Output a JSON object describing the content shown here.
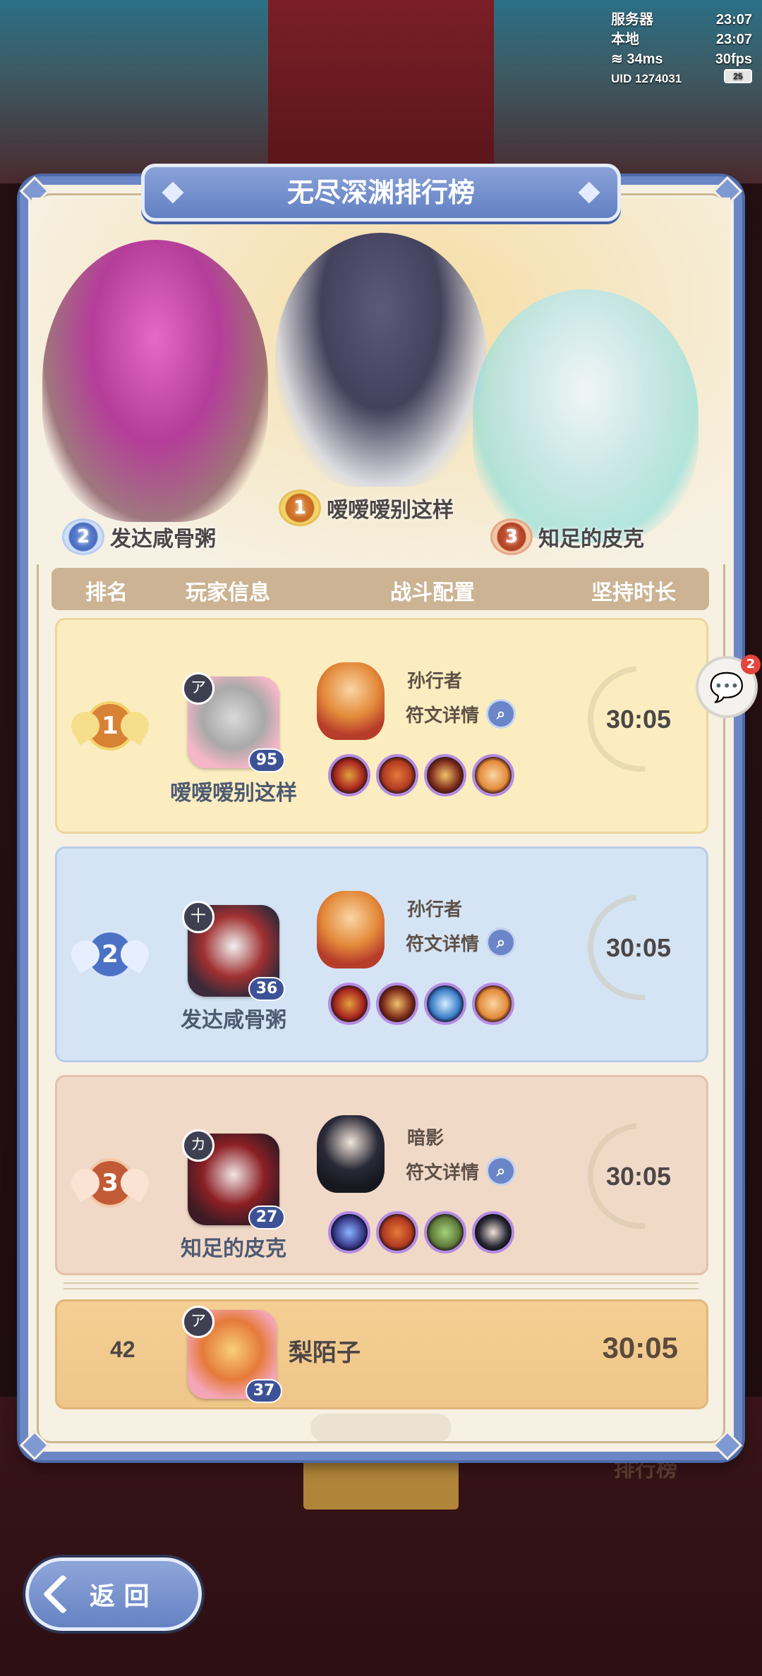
{
  "status": {
    "server_label": "服务器",
    "server_time": "23:07",
    "local_label": "本地",
    "local_time": "23:07",
    "ping": "34ms",
    "fps": "30fps",
    "uid": "UID 1274031",
    "battery": "25"
  },
  "panel": {
    "title": "无尽深渊排行榜"
  },
  "podium": [
    {
      "rank": "1",
      "name": "嗳嗳嗳别这样"
    },
    {
      "rank": "2",
      "name": "发达咸骨粥"
    },
    {
      "rank": "3",
      "name": "知足的皮克"
    }
  ],
  "table": {
    "headers": {
      "rank": "排名",
      "player": "玩家信息",
      "battle": "战斗配置",
      "duration": "坚持时长"
    },
    "rows": [
      {
        "rank": "1",
        "player_name": "嗳嗳嗳别这样",
        "level": "95",
        "hero_name": "孙行者",
        "rune_link": "符文详情",
        "equipment": [
          "firecracker-icon",
          "book-icon",
          "arrows-icon",
          "hero-icon"
        ],
        "duration": "30:05"
      },
      {
        "rank": "2",
        "player_name": "发达咸骨粥",
        "level": "36",
        "hero_name": "孙行者",
        "rune_link": "符文详情",
        "equipment": [
          "firecracker-icon",
          "arrows-icon",
          "feather-icon",
          "hero-icon"
        ],
        "duration": "30:05"
      },
      {
        "rank": "3",
        "player_name": "知足的皮克",
        "level": "27",
        "hero_name": "暗影",
        "rune_link": "符文详情",
        "equipment": [
          "moon-icon",
          "book-icon",
          "leaf-icon",
          "shadow-hero-icon"
        ],
        "duration": "30:05"
      }
    ]
  },
  "my_rank": {
    "rank": "42",
    "player_name": "梨陌子",
    "level": "37",
    "duration": "30:05"
  },
  "chat": {
    "badge_count": "2"
  },
  "buttons": {
    "back_label": "返 回"
  },
  "ghost_label": "排行榜",
  "colors": {
    "panel_border": "#6c87c5",
    "gold_row": "#fbedc0",
    "silver_row": "#d5e4f4",
    "bronze_row": "#f1d9c8",
    "my_row": "#f4ce93"
  }
}
